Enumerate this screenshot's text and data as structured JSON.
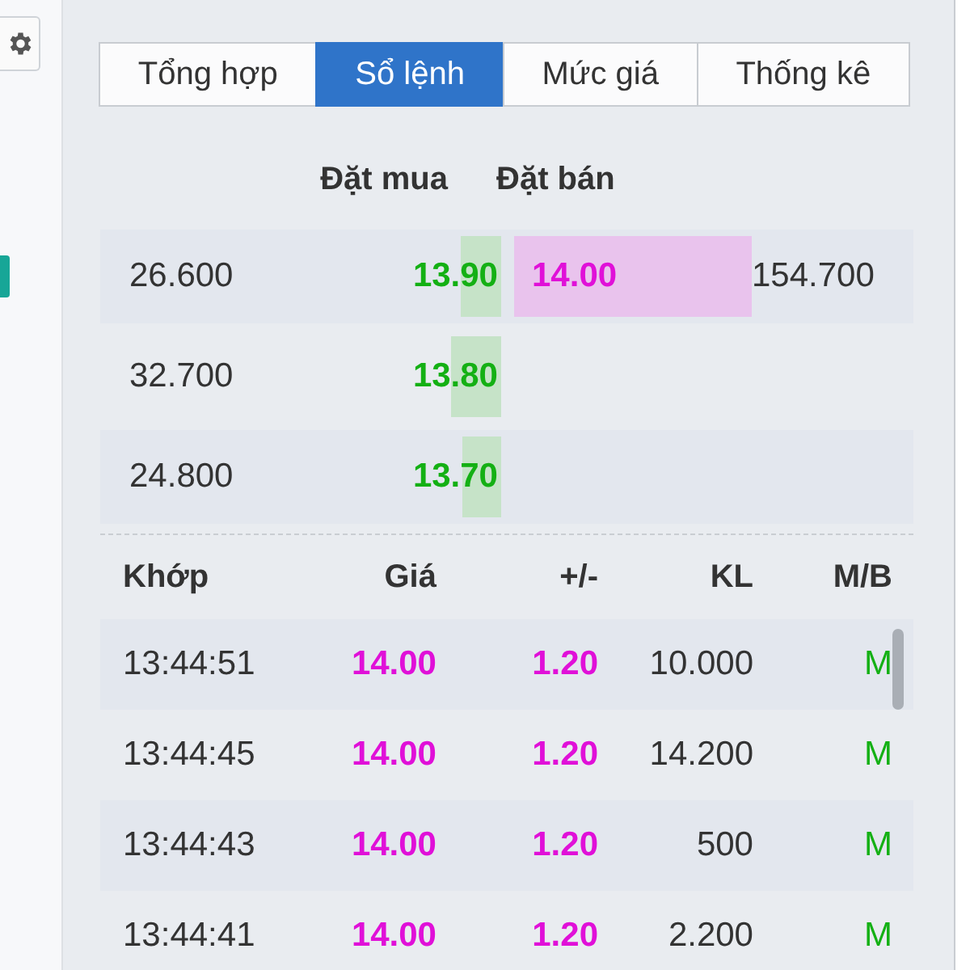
{
  "tabs": [
    {
      "label": "Tổng hợp",
      "selected": false
    },
    {
      "label": "Sổ lệnh",
      "selected": true
    },
    {
      "label": "Mức giá",
      "selected": false
    },
    {
      "label": "Thống kê",
      "selected": false
    }
  ],
  "order_book": {
    "headers": [
      "Đặt mua",
      "Đặt bán"
    ],
    "rows": [
      {
        "bid": {
          "volume": "26.600",
          "price": "13.90"
        },
        "ask": {
          "price": "14.00",
          "volume": "154.700"
        }
      },
      {
        "bid": {
          "volume": "32.700",
          "price": "13.80"
        }
      },
      {
        "bid": {
          "volume": "24.800",
          "price": "13.70"
        }
      }
    ]
  },
  "trades": {
    "columns": [
      "Khớp",
      "Giá",
      "+/-",
      "KL",
      "M/B"
    ],
    "rows": [
      {
        "time": "13:44:51",
        "price": "14.00",
        "change": "1.20",
        "volume": "10.000",
        "side": "M"
      },
      {
        "time": "13:44:45",
        "price": "14.00",
        "change": "1.20",
        "volume": "14.200",
        "side": "M"
      },
      {
        "time": "13:44:43",
        "price": "14.00",
        "change": "1.20",
        "volume": "500",
        "side": "M"
      },
      {
        "time": "13:44:41",
        "price": "14.00",
        "change": "1.20",
        "volume": "2.200",
        "side": "M"
      }
    ]
  }
}
